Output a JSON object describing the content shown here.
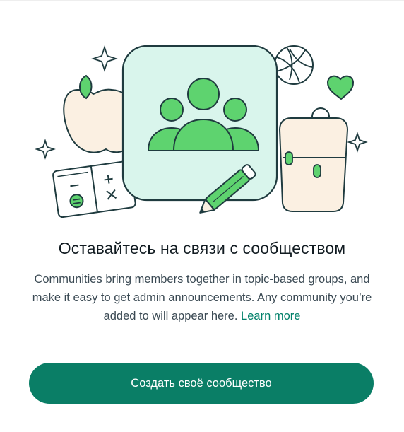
{
  "empty_state": {
    "title": "Оставайтесь на связи с сообществом",
    "description": "Communities bring members together in topic-based groups, and make it easy to get admin announcements. Any community you’re added to will appear here.",
    "learn_more_label": "Learn more"
  },
  "actions": {
    "create_community_label": "Создать своё сообщество"
  },
  "colors": {
    "accent": "#008069",
    "button": "#0a7e66",
    "illustration_green": "#5ed36f",
    "illustration_mint": "#d9f5ec",
    "illustration_cream": "#fbf0e2",
    "outline": "#1f3b3f"
  },
  "illustration": {
    "icons": [
      "community-icon",
      "apple-icon",
      "volleyball-icon",
      "heart-icon",
      "backpack-icon",
      "notebook-icon",
      "pencil-icon",
      "sparkle-icon"
    ]
  }
}
